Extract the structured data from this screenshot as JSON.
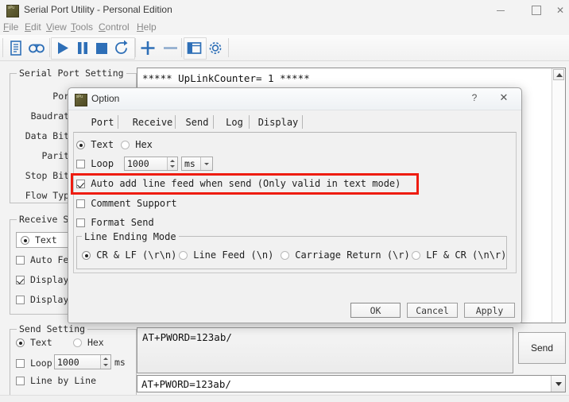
{
  "window": {
    "title": "Serial Port Utility - Personal Edition",
    "icon": "app-icon",
    "controls": {
      "minimize": "–",
      "maximize": "□",
      "close": "✕"
    }
  },
  "menubar": {
    "items": [
      {
        "label": "File",
        "mnemonic": "F"
      },
      {
        "label": "Edit",
        "mnemonic": "E"
      },
      {
        "label": "View",
        "mnemonic": "V"
      },
      {
        "label": "Tools",
        "mnemonic": "T"
      },
      {
        "label": "Control",
        "mnemonic": "C"
      },
      {
        "label": "Help",
        "mnemonic": "H"
      }
    ]
  },
  "toolbar": {
    "icons": [
      "new-document-icon",
      "record-icon",
      "play-icon",
      "pause-icon",
      "stop-icon",
      "refresh-icon",
      "plus-icon",
      "minus-icon",
      "panel-icon",
      "settings-gear-icon"
    ]
  },
  "serial_port_setting": {
    "title": "Serial Port Setting",
    "rows": [
      {
        "label": "Port"
      },
      {
        "label": "Baudrate"
      },
      {
        "label": "Data Bits"
      },
      {
        "label": "Parity"
      },
      {
        "label": "Stop Bits"
      },
      {
        "label": "Flow Type"
      }
    ]
  },
  "receive_setting": {
    "title": "Receive S",
    "mode_text": "Text",
    "mode_text_selected": true,
    "rows": [
      {
        "label": "Auto Fe",
        "checked": false
      },
      {
        "label": "Display",
        "checked": true
      },
      {
        "label": "Display",
        "checked": false
      }
    ]
  },
  "send_setting": {
    "title": "Send Setting",
    "text_label": "Text",
    "text_selected": true,
    "hex_label": "Hex",
    "hex_selected": false,
    "loop_label": "Loop",
    "loop_checked": false,
    "loop_value": "1000",
    "loop_unit": "ms",
    "line_by_line_label": "Line by Line",
    "line_by_line_checked": false
  },
  "receive_area": {
    "text": "***** UpLinkCounter= 1 *****",
    "scrollbar": "vertical-scrollbar"
  },
  "send_area": {
    "text": "AT+PWORD=123ab/",
    "send_button": "Send",
    "history_value": "AT+PWORD=123ab/"
  },
  "dialog": {
    "title": "Option",
    "icon": "app-icon",
    "help_label": "?",
    "close_label": "✕",
    "tabs": [
      {
        "label": "Port",
        "active": false
      },
      {
        "label": "Receive",
        "active": false
      },
      {
        "label": "Send",
        "active": true
      },
      {
        "label": "Log",
        "active": false
      },
      {
        "label": "Display",
        "active": false
      }
    ],
    "mode": {
      "text_label": "Text",
      "text_selected": true,
      "hex_label": "Hex",
      "hex_selected": false
    },
    "loop": {
      "label": "Loop",
      "checked": false,
      "value": "1000",
      "unit": "ms"
    },
    "options": [
      {
        "label": "Auto add line feed when send (Only valid in text mode)",
        "checked": true,
        "highlighted": true
      },
      {
        "label": "Comment Support",
        "checked": false,
        "highlighted": false
      },
      {
        "label": "Format Send",
        "checked": false,
        "highlighted": false
      }
    ],
    "line_ending_mode": {
      "title": "Line Ending Mode",
      "options": [
        {
          "label": "CR & LF (\\r\\n)",
          "selected": true
        },
        {
          "label": "Line Feed (\\n)",
          "selected": false
        },
        {
          "label": "Carriage Return (\\r)",
          "selected": false
        },
        {
          "label": "LF & CR (\\n\\r)",
          "selected": false
        }
      ]
    },
    "buttons": {
      "ok": "OK",
      "cancel": "Cancel",
      "apply": "Apply"
    }
  },
  "colors": {
    "highlight_red": "#ee1c10",
    "toolbar_blue": "#2e6fb7",
    "window_bg": "#f3f3f3"
  }
}
